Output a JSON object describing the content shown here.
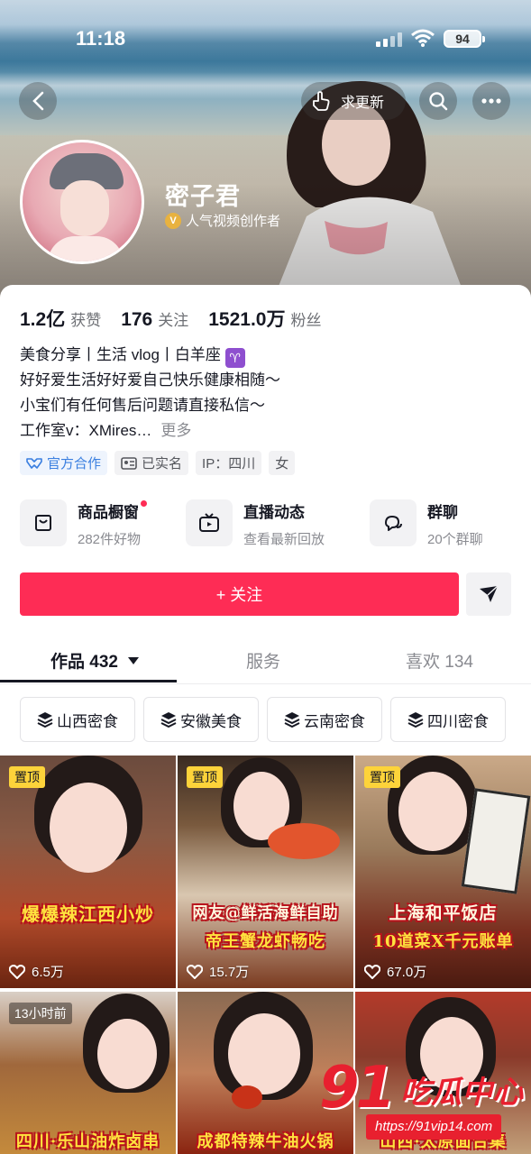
{
  "status_bar": {
    "time": "11:18",
    "battery": "94"
  },
  "header": {
    "update_label": "求更新",
    "nickname": "密子君",
    "verify_badge": "V",
    "creator_title": "人气视频创作者"
  },
  "stats": [
    {
      "num": "1.2亿",
      "label": "获赞"
    },
    {
      "num": "176",
      "label": "关注"
    },
    {
      "num": "1521.0万",
      "label": "粉丝"
    }
  ],
  "bio": {
    "line1_prefix": "美食分享丨生活 vlog丨白羊座",
    "zodiac": "♈",
    "line2": "好好爱生活好好爱自己快乐健康相随～",
    "line3": "小宝们有任何售后问题请直接私信～",
    "line4": "工作室v：XMires…",
    "more": "更多"
  },
  "tags": [
    {
      "label": "官方合作",
      "icon": "handshake-icon"
    },
    {
      "label": "已实名",
      "icon": "id-card-icon"
    },
    {
      "label": "IP：四川"
    },
    {
      "label": "女"
    }
  ],
  "services": [
    {
      "title": "商品橱窗",
      "sub": "282件好物",
      "icon": "shop-bag-icon"
    },
    {
      "title": "直播动态",
      "sub": "查看最新回放",
      "icon": "tv-icon"
    },
    {
      "title": "群聊",
      "sub": "20个群聊",
      "icon": "chat-bubble-icon"
    }
  ],
  "follow_label": "+ 关注",
  "tabs": {
    "works": "作品 432",
    "service": "服务",
    "likes": "喜欢 134"
  },
  "chips": [
    "山西密食",
    "安徽美食",
    "云南密食",
    "四川密食"
  ],
  "videos": [
    {
      "badge": "置顶",
      "headline1": "爆爆辣江西小炒",
      "headline2": "",
      "likes": "6.5万"
    },
    {
      "badge": "置顶",
      "headline1": "网友@鲜活海鲜自助",
      "headline2": "帝王蟹龙虾畅吃",
      "likes": "15.7万"
    },
    {
      "badge": "置顶",
      "headline1": "上海和平饭店",
      "headline2": "10道菜X千元账单",
      "likes": "67.0万"
    },
    {
      "badge": "13小时前",
      "headline1": "四川·乐山油炸卤串",
      "headline2": "",
      "likes": ""
    },
    {
      "badge": "",
      "headline1": "成都特辣牛油火锅",
      "headline2": "",
      "likes": ""
    },
    {
      "badge": "",
      "headline1": "山西·太原面合集",
      "headline2": "",
      "likes": ""
    }
  ],
  "watermark": {
    "num": "91",
    "text": "吃瓜中心",
    "url": "https://91vip14.com"
  }
}
